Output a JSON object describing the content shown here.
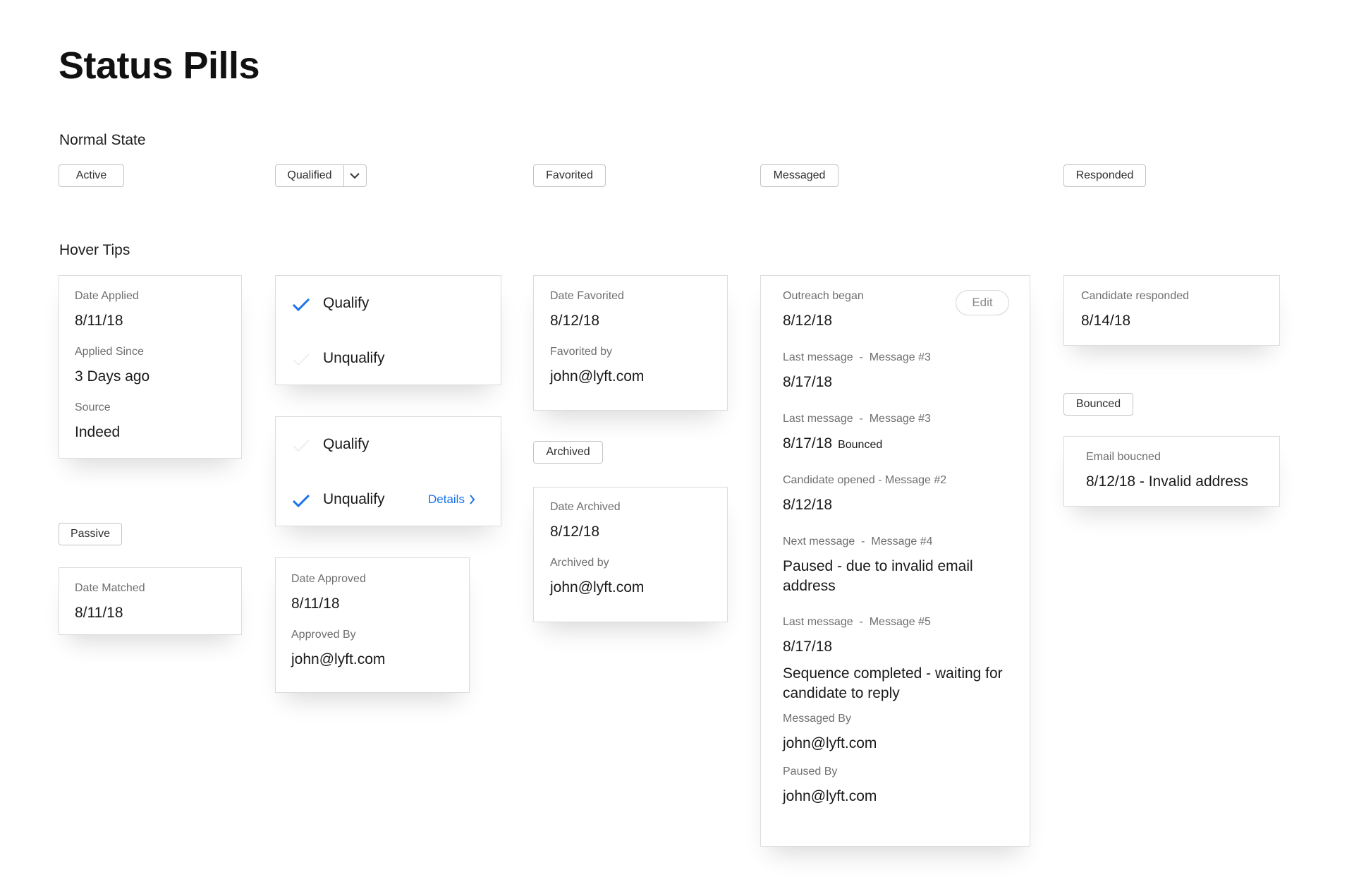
{
  "page": {
    "title": "Status Pills"
  },
  "sections": {
    "normal": "Normal State",
    "hover": "Hover Tips"
  },
  "pills": {
    "active": "Active",
    "qualified": "Qualified",
    "favorited": "Favorited",
    "messaged": "Messaged",
    "responded": "Responded",
    "passive": "Passive",
    "archived": "Archived",
    "bounced": "Bounced"
  },
  "applied_card": {
    "date_label": "Date Applied",
    "date": "8/11/18",
    "since_label": "Applied Since",
    "since": "3 Days ago",
    "source_label": "Source",
    "source": "Indeed"
  },
  "matched_card": {
    "date_label": "Date Matched",
    "date": "8/11/18"
  },
  "qualify_menu_1": {
    "qualify": "Qualify",
    "unqualify": "Unqualify",
    "selected": "qualify"
  },
  "qualify_menu_2": {
    "qualify": "Qualify",
    "unqualify": "Unqualify",
    "details": "Details",
    "selected": "unqualify"
  },
  "approved_card": {
    "date_label": "Date Approved",
    "date": "8/11/18",
    "by_label": "Approved By",
    "by": "john@lyft.com"
  },
  "favorited_card": {
    "date_label": "Date Favorited",
    "date": "8/12/18",
    "by_label": "Favorited by",
    "by": "john@lyft.com"
  },
  "archived_card": {
    "date_label": "Date Archived",
    "date": "8/12/18",
    "by_label": "Archived by",
    "by": "john@lyft.com"
  },
  "messaged_card": {
    "edit": "Edit",
    "outreach_label": "Outreach began",
    "outreach_date": "8/12/18",
    "last1_label": "Last message",
    "last1_msg": "Message #3",
    "last1_date": "8/17/18",
    "last2_label": "Last message",
    "last2_msg": "Message #3",
    "last2_date": "8/17/18",
    "last2_badge": "Bounced",
    "opened_label": "Candidate opened - Message #2",
    "opened_date": "8/12/18",
    "next_label": "Next message",
    "next_msg": "Message #4",
    "next_status": "Paused - due to invalid email address",
    "last3_label": "Last message",
    "last3_msg": "Message #5",
    "last3_date": "8/17/18",
    "last3_status": "Sequence completed - waiting for candidate to reply",
    "messaged_by_label": "Messaged By",
    "messaged_by": "john@lyft.com",
    "paused_by_label": "Paused By",
    "paused_by": "john@lyft.com"
  },
  "responded_card": {
    "label": "Candidate responded",
    "date": "8/14/18"
  },
  "bounced_card": {
    "label": "Email boucned",
    "value": "8/12/18 - Invalid address"
  },
  "colors": {
    "accent": "#1a73e8",
    "border": "#c4c4c4",
    "muted_text": "#6f6f6f"
  },
  "icons": {
    "check": "check-icon",
    "chevron_down": "chevron-down-icon",
    "chevron_right": "chevron-right-icon"
  }
}
